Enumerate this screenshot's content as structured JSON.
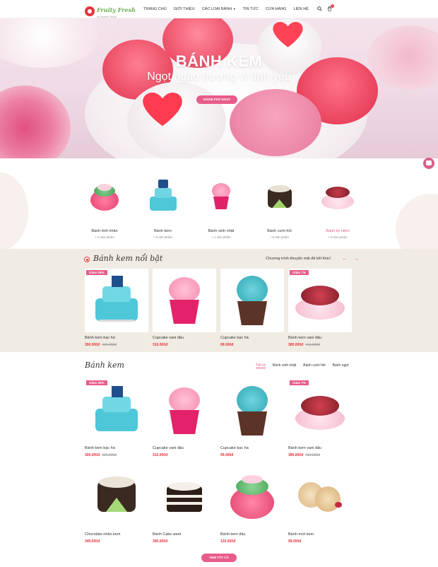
{
  "header": {
    "logo_title": "Fruity Fresh",
    "logo_sub": "by Motion Store",
    "nav": [
      "Trang chủ",
      "Giới thiệu",
      "Các loại bánh",
      "Tin tức",
      "Cửa hàng",
      "Liên hệ"
    ],
    "cart_count": "0"
  },
  "hero": {
    "title": "BÁNH KEM",
    "subtitle": "Ngọt ngào hương vị tình yêu",
    "button": "Khám phá ngay"
  },
  "categories": [
    {
      "name": "Bánh tình nhân",
      "count": "+ 6 sản phẩm"
    },
    {
      "name": "Bánh kem",
      "count": "+ 8 sản phẩm"
    },
    {
      "name": "Bánh sinh nhật",
      "count": "+ 1 sản phẩm"
    },
    {
      "name": "Bánh cưới hỏi",
      "count": "+ 8 sản phẩm"
    },
    {
      "name": "Bánh kỷ niệm",
      "count": "+ 8 sản phẩm"
    }
  ],
  "featured": {
    "title": "Bánh kem nổi bật",
    "promo": "Chương trình khuyến mãi đã kết thúc!",
    "arrows": "← →",
    "products": [
      {
        "badge": "Giảm 29%",
        "name": "Bánh kem bạc hà",
        "price": "300.000đ",
        "old": "420.000đ"
      },
      {
        "badge": "",
        "name": "Cupcake vani dâu",
        "price": "310.000đ",
        "old": ""
      },
      {
        "badge": "",
        "name": "Cupcake bạc hà",
        "price": "99.000đ",
        "old": ""
      },
      {
        "badge": "Giảm 7%",
        "name": "Bánh kem vani dâu",
        "price": "380.000đ",
        "old": "410.000đ"
      }
    ]
  },
  "section": {
    "title": "Bánh kem",
    "tabs": [
      "Tất cả",
      "Bánh sinh nhật",
      "Bánh cưới hỏi",
      "Bánh ngọt"
    ],
    "products": [
      {
        "badge": "Giảm 29%",
        "name": "Bánh kem bạc hà",
        "price": "300.000đ",
        "old": "420.000đ"
      },
      {
        "badge": "",
        "name": "Cupcake vani dâu",
        "price": "310.000đ",
        "old": ""
      },
      {
        "badge": "",
        "name": "Cupcake bạc hà",
        "price": "99.000đ",
        "old": ""
      },
      {
        "badge": "Giảm 7%",
        "name": "Bánh kem vani dâu",
        "price": "380.000đ",
        "old": "410.000đ"
      },
      {
        "badge": "",
        "name": "Chocolate nhân kem",
        "price": "349.000đ",
        "old": ""
      },
      {
        "badge": "",
        "name": "Bánh Cake weet",
        "price": "390.000đ",
        "old": ""
      },
      {
        "badge": "",
        "name": "Bánh kem dâu",
        "price": "120.000đ",
        "old": ""
      },
      {
        "badge": "",
        "name": "Bánh mứt kem",
        "price": "99.000đ",
        "old": ""
      }
    ],
    "view_all": "Xem tất cả"
  },
  "colors": {
    "accent": "#e85c8a",
    "price": "#e8323c",
    "brand_green": "#6ab04c"
  }
}
